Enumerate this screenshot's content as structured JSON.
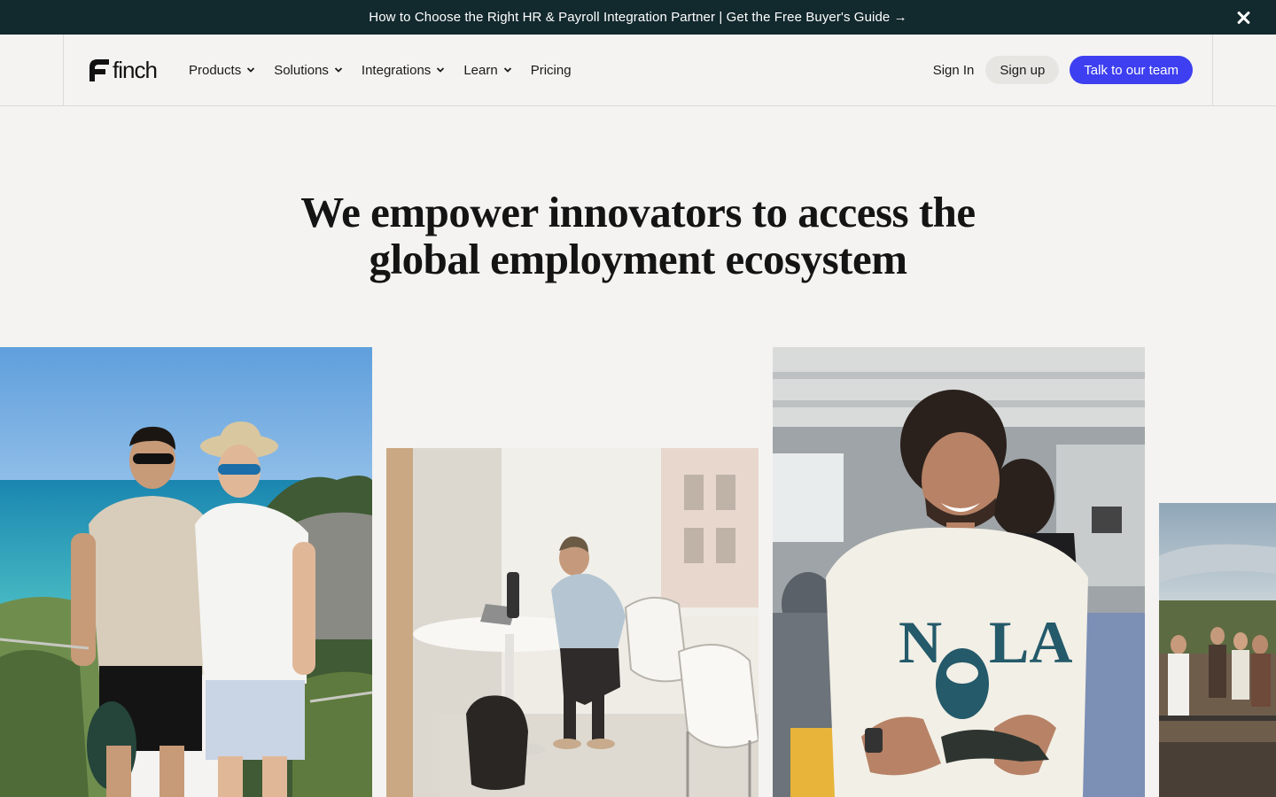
{
  "announcement": {
    "text": "How to Choose the Right HR & Payroll Integration Partner | Get the Free Buyer's Guide →",
    "close_icon": "close-icon"
  },
  "header": {
    "logo_text": "finch",
    "nav": [
      {
        "label": "Products",
        "has_dropdown": true
      },
      {
        "label": "Solutions",
        "has_dropdown": true
      },
      {
        "label": "Integrations",
        "has_dropdown": true
      },
      {
        "label": "Learn",
        "has_dropdown": true
      },
      {
        "label": "Pricing",
        "has_dropdown": false
      }
    ],
    "sign_in": "Sign In",
    "sign_up": "Sign up",
    "cta": "Talk to our team"
  },
  "hero": {
    "title_line1": "We empower innovators to access the",
    "title_line2": "global employment ecosystem"
  },
  "colors": {
    "banner": "#12292e",
    "background": "#f4f3f1",
    "accent": "#3d3ff0"
  }
}
